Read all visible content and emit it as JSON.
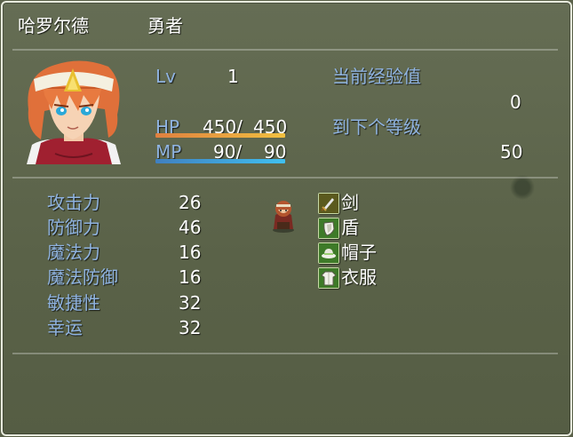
{
  "actor": {
    "name": "哈罗尔德",
    "class": "勇者",
    "level_label": "Lv",
    "level": "1",
    "hp_label": "HP",
    "hp": "450/",
    "hp_max": "450",
    "hp_ratio": 1.0,
    "mp_label": "MP",
    "mp": "90/",
    "mp_max": "90",
    "mp_ratio": 1.0
  },
  "exp": {
    "current_label": "当前经验值",
    "current": "0",
    "next_label": "到下个等级",
    "next": "50"
  },
  "params": [
    {
      "label": "攻击力",
      "value": "26"
    },
    {
      "label": "防御力",
      "value": "46"
    },
    {
      "label": "魔法力",
      "value": "16"
    },
    {
      "label": "魔法防御",
      "value": "16"
    },
    {
      "label": "敏捷性",
      "value": "32"
    },
    {
      "label": "幸运",
      "value": "32"
    }
  ],
  "equips": [
    {
      "icon": "sword-icon",
      "name": "剑"
    },
    {
      "icon": "shield-icon",
      "name": "盾"
    },
    {
      "icon": "hat-icon",
      "name": "帽子"
    },
    {
      "icon": "clothes-icon",
      "name": "衣服"
    }
  ],
  "colors": {
    "window_bg": "#5f674d",
    "system_text": "#8fb3e0",
    "normal_text": "#ffffff",
    "hp_gauge_start": "#e08040",
    "hp_gauge_end": "#f0c040",
    "mp_gauge_start": "#4080c0",
    "mp_gauge_end": "#40c0f0"
  }
}
